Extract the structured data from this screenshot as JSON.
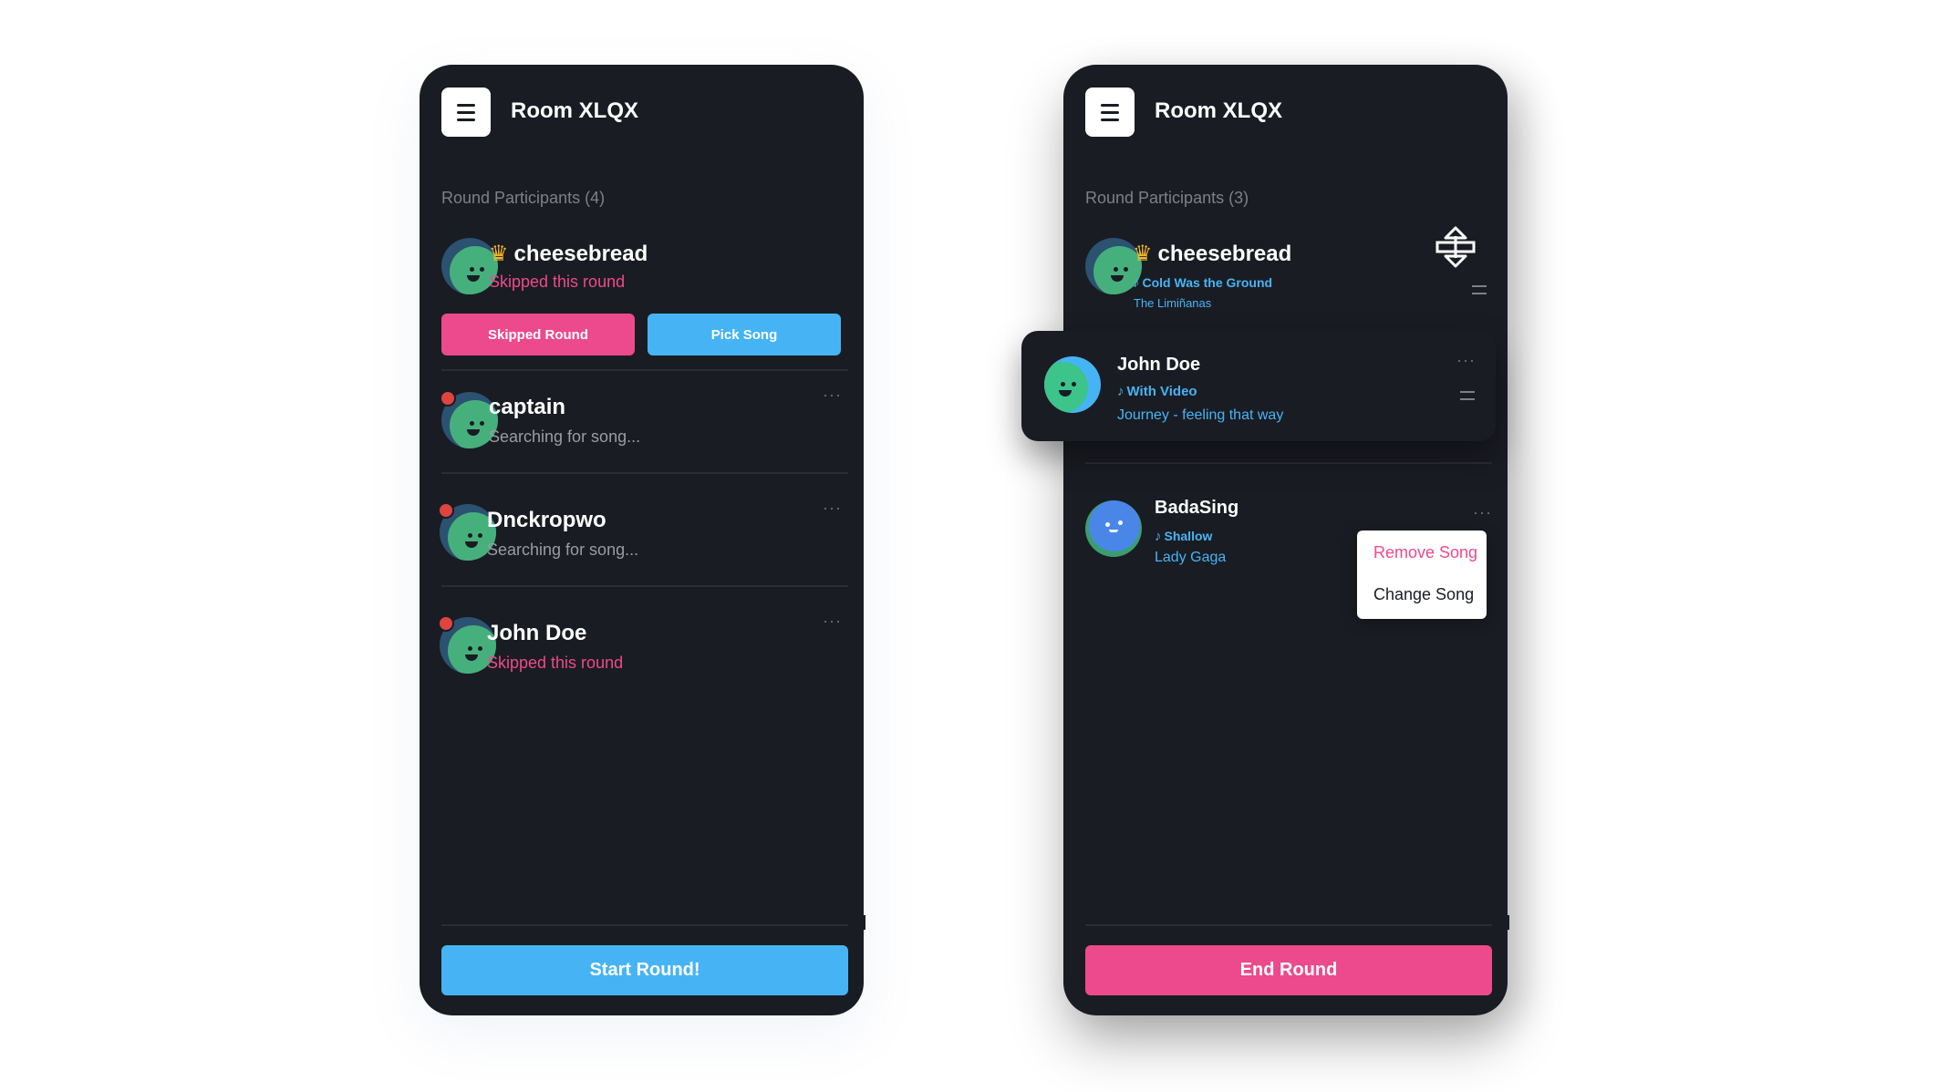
{
  "left_screen": {
    "room_title": "Room XLQX",
    "section_label": "Round Participants",
    "participant_count": "(4)",
    "host": {
      "name": "cheesebread",
      "status": "Skipped this round",
      "skipped_button": "Skipped Round",
      "pick_button": "Pick Song"
    },
    "participants": [
      {
        "name": "captain",
        "status": "Searching for song..."
      },
      {
        "name": "Dnckropwo",
        "status": "Searching for song..."
      },
      {
        "name": "John Doe",
        "status": "Skipped this round"
      }
    ],
    "more_label": "···",
    "start_button": "Start Round!"
  },
  "right_screen": {
    "room_title": "Room XLQX",
    "section_label": "Round Participants",
    "participant_count": "(3)",
    "host": {
      "name": "cheesebread",
      "song": "Cold Was the Ground",
      "artist": "The Limiñanas"
    },
    "dragged": {
      "name": "John Doe",
      "song": "With Video",
      "artist": "Journey - feeling that way"
    },
    "third": {
      "name": "BadaSing",
      "song": "Shallow",
      "artist": "Lady Gaga"
    },
    "menu": {
      "remove": "Remove Song",
      "change": "Change Song"
    },
    "more_label": "···",
    "end_button": "End Round"
  },
  "colors": {
    "background": "#1a1c23",
    "pink": "#ec4a8c",
    "blue": "#46b4f4",
    "crown": "#f2b630"
  },
  "icons": [
    "menu-icon",
    "crown-icon",
    "music-note-icon",
    "more-icon",
    "drag-handle-icon",
    "move-cursor-icon"
  ]
}
